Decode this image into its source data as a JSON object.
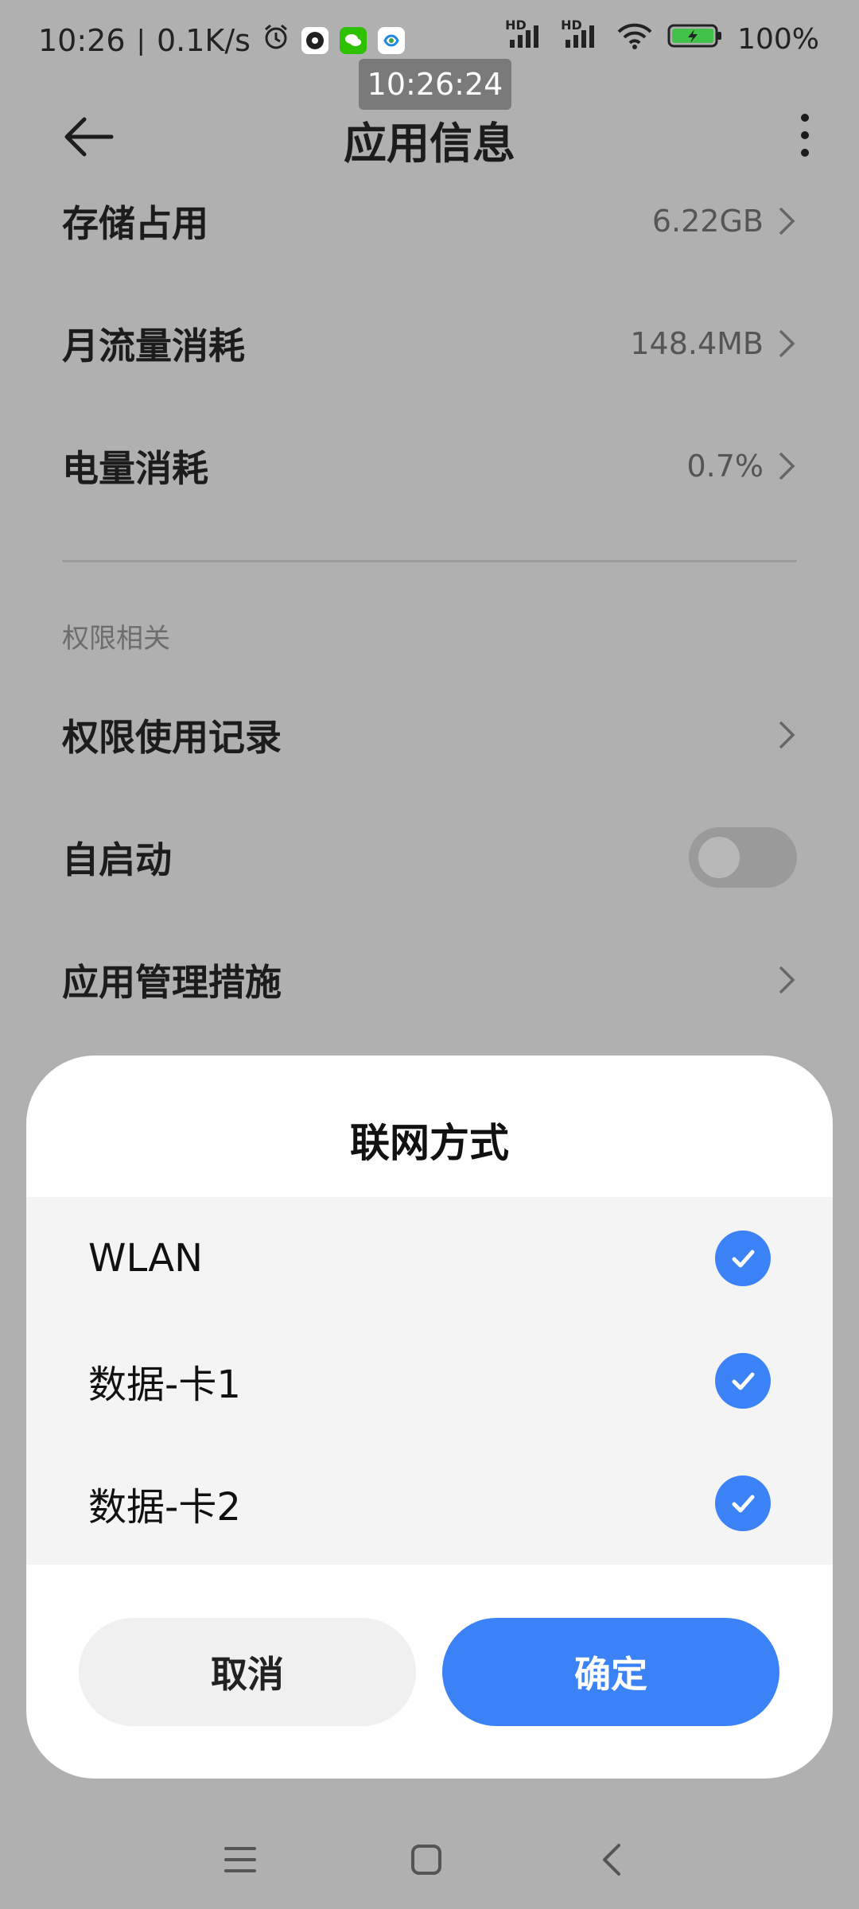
{
  "status_bar": {
    "time": "10:26",
    "net_speed": "0.1K/s",
    "battery": "100%",
    "network_hd_1": "HD",
    "network_hd_2": "HD",
    "clock_overlay": "10:26:24"
  },
  "header": {
    "title": "应用信息"
  },
  "rows": [
    {
      "label": "存储占用",
      "value": "6.22GB"
    },
    {
      "label": "月流量消耗",
      "value": "148.4MB"
    },
    {
      "label": "电量消耗",
      "value": "0.7%"
    }
  ],
  "permissions": {
    "section_title": "权限相关",
    "items": [
      {
        "label": "权限使用记录"
      },
      {
        "label": "自启动",
        "toggle_on": false
      },
      {
        "label": "应用管理措施"
      }
    ]
  },
  "dialog": {
    "title": "联网方式",
    "options": [
      {
        "label": "WLAN",
        "checked": true
      },
      {
        "label": "数据-卡1",
        "checked": true
      },
      {
        "label": "数据-卡2",
        "checked": true
      }
    ],
    "cancel_label": "取消",
    "confirm_label": "确定"
  },
  "colors": {
    "accent": "#3b82f6",
    "scrim_background": "#b0b0b0",
    "dialog_background": "#ffffff",
    "options_background": "#f4f4f4"
  },
  "icons": {
    "status": [
      "alarm-icon",
      "app-icon",
      "wechat-icon",
      "mobile-app-icon",
      "signal-icon",
      "wifi-icon",
      "battery-icon"
    ],
    "navigation": [
      "back-arrow-icon",
      "more-vert-icon",
      "chevron-right-icon",
      "check-icon",
      "menu-icon",
      "home-icon",
      "nav-back-icon"
    ]
  }
}
